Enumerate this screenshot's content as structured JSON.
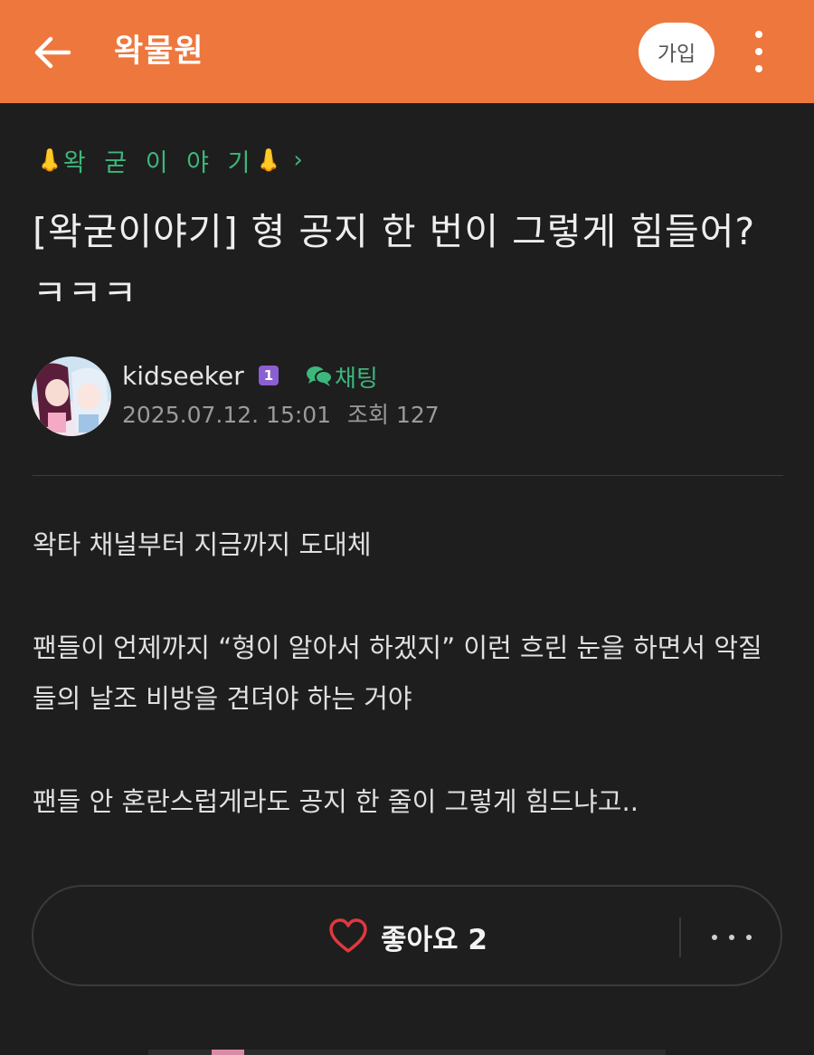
{
  "header": {
    "app_title": "왁물원",
    "join_label": "가입",
    "background_color": "#ee773d",
    "icons": [
      "back-arrow-icon",
      "more-vertical-icon"
    ]
  },
  "post": {
    "category": "왁 굳 이 야 기",
    "category_emoji": "👃",
    "category_color": "#3db77b",
    "title": "[왁굳이야기] 형 공지 한 번이 그렇게 힘들어? ㅋㅋㅋ",
    "author": {
      "name": "kidseeker",
      "level": "1",
      "chat_label": "채팅"
    },
    "date": "2025.07.12. 15:01",
    "views": "조회 127",
    "body": [
      "왁타 채널부터 지금까지 도대체",
      "팬들이 언제까지 “형이 알아서 하겠지” 이런 흐린 눈을 하면서 악질들의 날조 비방을 견뎌야 하는 거야",
      "팬들 안 혼란스럽게라도 공지 한 줄이 그렇게 힘드냐고.."
    ]
  },
  "actions": {
    "like_label": "좋아요 2",
    "like_count": 2
  }
}
